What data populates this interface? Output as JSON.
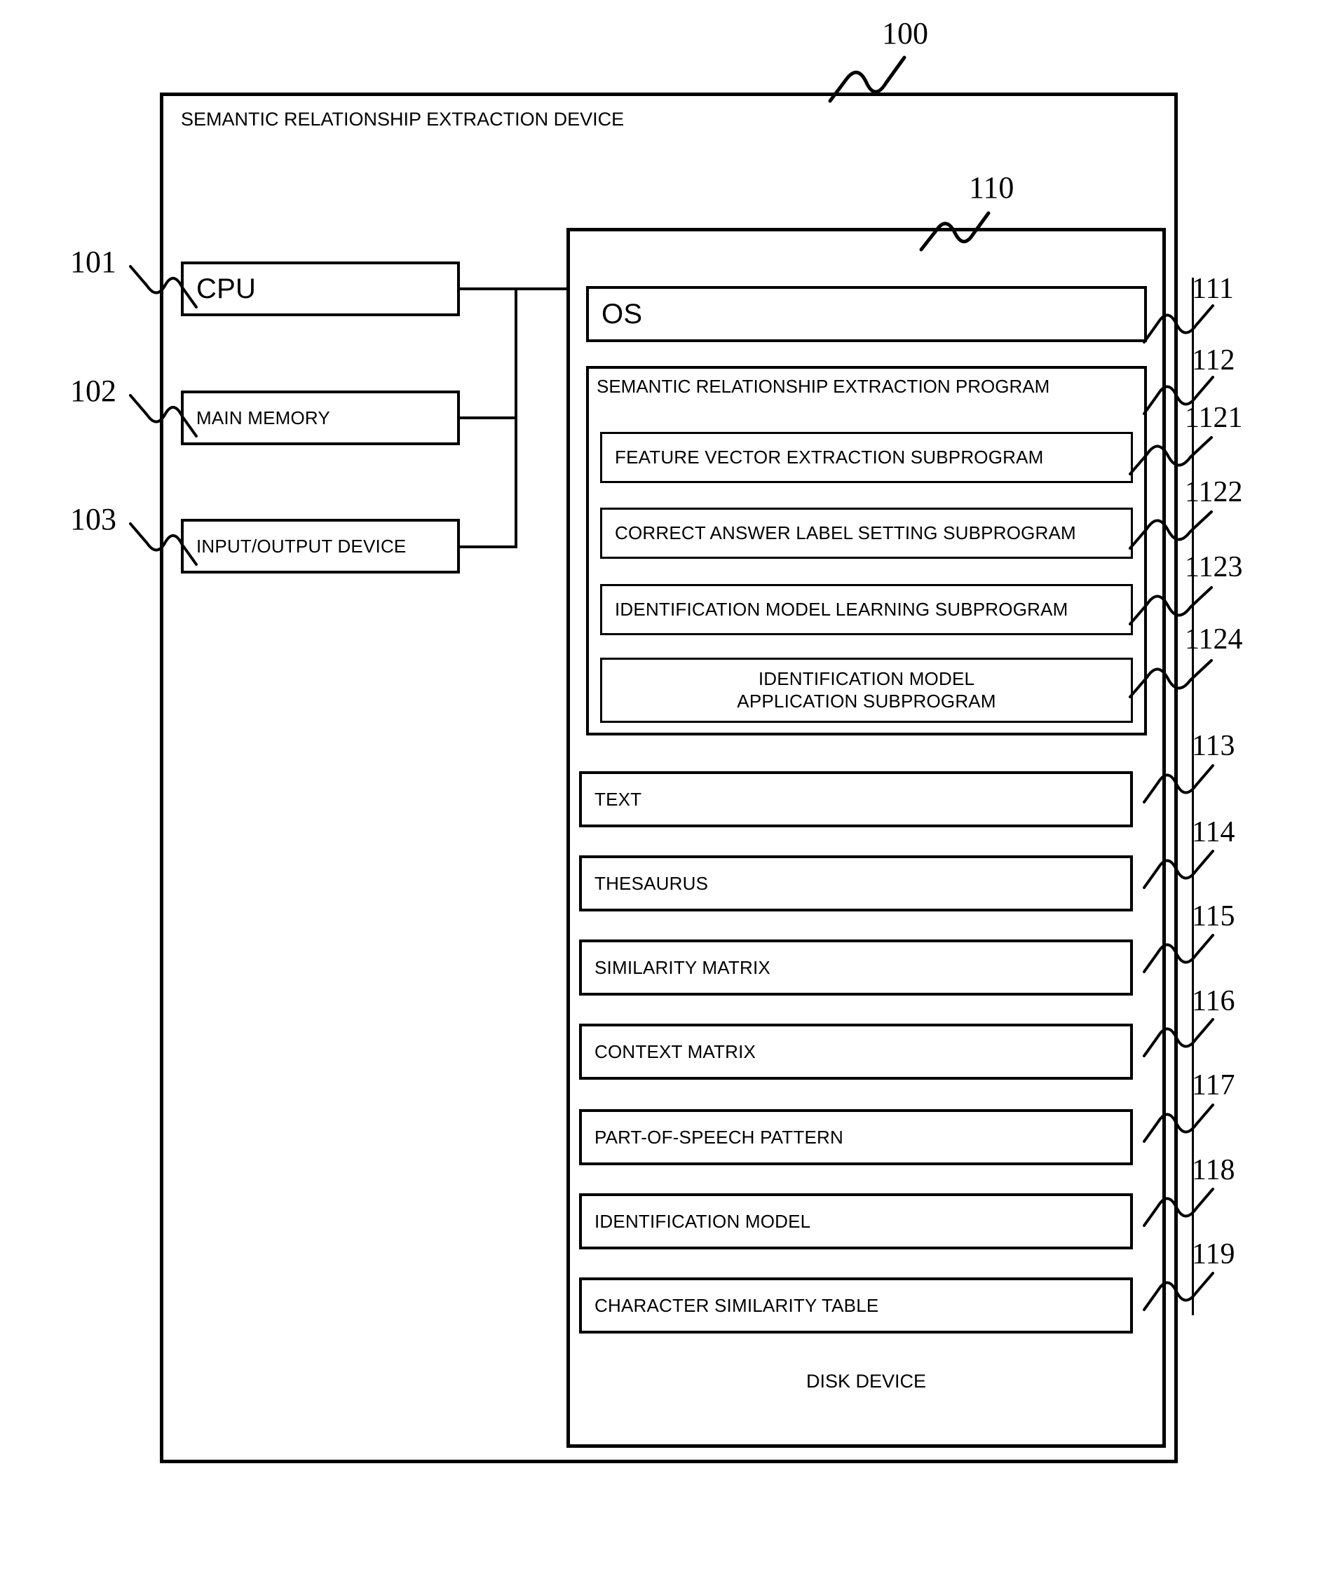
{
  "figure": {
    "device_title": "SEMANTIC RELATIONSHIP EXTRACTION DEVICE",
    "device_ref": "100",
    "disk_ref": "110",
    "disk_label": "DISK DEVICE"
  },
  "hardware": [
    {
      "ref": "101",
      "label": "CPU"
    },
    {
      "ref": "102",
      "label": "MAIN MEMORY"
    },
    {
      "ref": "103",
      "label": "INPUT/OUTPUT DEVICE"
    }
  ],
  "software": {
    "os": {
      "ref": "111",
      "label": "OS"
    },
    "program": {
      "ref": "112",
      "label": "SEMANTIC RELATIONSHIP EXTRACTION PROGRAM",
      "subprograms": [
        {
          "ref": "1121",
          "label": "FEATURE VECTOR EXTRACTION SUBPROGRAM"
        },
        {
          "ref": "1122",
          "label": "CORRECT ANSWER LABEL SETTING SUBPROGRAM"
        },
        {
          "ref": "1123",
          "label": "IDENTIFICATION MODEL LEARNING SUBPROGRAM"
        },
        {
          "ref": "1124",
          "label_line1": "IDENTIFICATION MODEL",
          "label_line2": "APPLICATION SUBPROGRAM"
        }
      ]
    }
  },
  "data_items": [
    {
      "ref": "113",
      "label": "TEXT"
    },
    {
      "ref": "114",
      "label": "THESAURUS"
    },
    {
      "ref": "115",
      "label": "SIMILARITY MATRIX"
    },
    {
      "ref": "116",
      "label": "CONTEXT MATRIX"
    },
    {
      "ref": "117",
      "label": "PART-OF-SPEECH PATTERN"
    },
    {
      "ref": "118",
      "label": "IDENTIFICATION MODEL"
    },
    {
      "ref": "119",
      "label": "CHARACTER SIMILARITY TABLE"
    }
  ],
  "colors": {
    "ink": "#000000",
    "paper": "#ffffff"
  }
}
